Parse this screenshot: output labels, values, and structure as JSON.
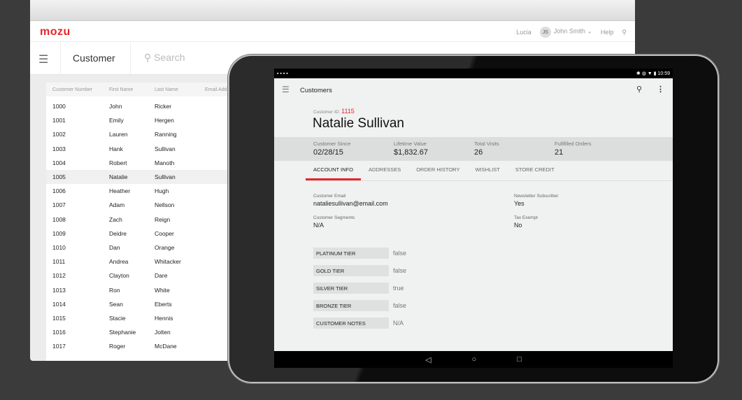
{
  "desktop": {
    "logo": "mozu",
    "header": {
      "store": "Lucia",
      "avatar": "JS",
      "user": "John Smith",
      "user_chevron": "⌄",
      "help": "Help"
    },
    "toolbar": {
      "title": "Customer",
      "search_placeholder": "Search"
    },
    "table": {
      "columns": [
        "Customer Number",
        "First Name",
        "Last Name",
        "Email Addr"
      ],
      "rows": [
        [
          "1000",
          "John",
          "Ricker"
        ],
        [
          "1001",
          "Emily",
          "Hergen"
        ],
        [
          "1002",
          "Lauren",
          "Ranning"
        ],
        [
          "1003",
          "Hank",
          "Sullivan"
        ],
        [
          "1004",
          "Robert",
          "Manoth"
        ],
        [
          "1005",
          "Natalie",
          "Sullivan"
        ],
        [
          "1006",
          "Heather",
          "Hugh"
        ],
        [
          "1007",
          "Adam",
          "Nellson"
        ],
        [
          "1008",
          "Zach",
          "Reign"
        ],
        [
          "1009",
          "Deidre",
          "Cooper"
        ],
        [
          "1010",
          "Dan",
          "Orange"
        ],
        [
          "1011",
          "Andrea",
          "Whitacker"
        ],
        [
          "1012",
          "Clayton",
          "Dare"
        ],
        [
          "1013",
          "Ron",
          "White"
        ],
        [
          "1014",
          "Sean",
          "Eberts"
        ],
        [
          "1015",
          "Stacie",
          "Hennis"
        ],
        [
          "1016",
          "Stephanie",
          "Jolten"
        ],
        [
          "1017",
          "Roger",
          "McDane"
        ]
      ]
    }
  },
  "tablet": {
    "status": {
      "time": "10:59"
    },
    "appbar": {
      "title": "Customers"
    },
    "customer": {
      "id_label": "Customer ID:",
      "id": "1115",
      "name": "Natalie Sullivan"
    },
    "stats": [
      {
        "label": "Customer Since",
        "value": "02/28/15"
      },
      {
        "label": "Lifetime Value",
        "value": "$1,832.67"
      },
      {
        "label": "Total Visits",
        "value": "26"
      },
      {
        "label": "Fullfilled Orders",
        "value": "21"
      }
    ],
    "tabs": [
      "ACCOUNT INFO",
      "ADDRESSES",
      "ORDER HISTORY",
      "WISHLIST",
      "STORE CREDIT"
    ],
    "fields": {
      "email_label": "Customer Email",
      "email": "nataliesullivan@email.com",
      "segments_label": "Customer Segments",
      "segments": "N/A",
      "newsletter_label": "Newsletter Subscriber",
      "newsletter": "Yes",
      "tax_label": "Tax Exempt",
      "tax": "No"
    },
    "attributes": [
      {
        "key": "PLATINUM TIER",
        "value": "false"
      },
      {
        "key": "GOLD TIER",
        "value": "false"
      },
      {
        "key": "SILVER TIER",
        "value": "true"
      },
      {
        "key": "BRONZE TIER",
        "value": "false"
      },
      {
        "key": "CUSTOMER NOTES",
        "value": "N/A"
      }
    ]
  }
}
